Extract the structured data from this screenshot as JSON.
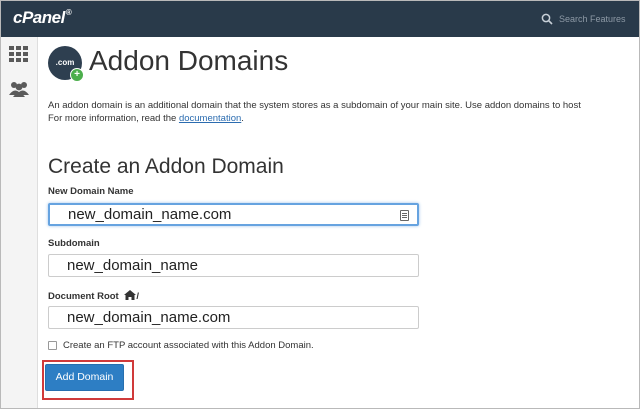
{
  "header": {
    "logo": "cPanel",
    "logo_mark": "®",
    "search_placeholder": "Search Features"
  },
  "rail": {
    "items": [
      "apps-grid-icon",
      "users-icon"
    ]
  },
  "page": {
    "icon_text": ".com",
    "title": "Addon Domains",
    "intro_line1": "An addon domain is an additional domain that the system stores as a subdomain of your main site. Use addon domains to host",
    "intro_line2_prefix": "For more information, read the ",
    "intro_link": "documentation",
    "intro_line2_suffix": "."
  },
  "form": {
    "title": "Create an Addon Domain",
    "new_domain_label": "New Domain Name",
    "new_domain_value": "new_domain_name.com",
    "subdomain_label": "Subdomain",
    "subdomain_value": "new_domain_name",
    "docroot_label": "Document Root",
    "docroot_suffix": "/",
    "docroot_value": "new_domain_name.com",
    "ftp_checkbox_label": "Create an FTP account associated with this Addon Domain.",
    "ftp_checked": false,
    "submit_label": "Add Domain"
  },
  "colors": {
    "topbar": "#293a4a",
    "button": "#2d7ec4",
    "highlight": "#d03a3a",
    "link": "#2b6cb0"
  }
}
